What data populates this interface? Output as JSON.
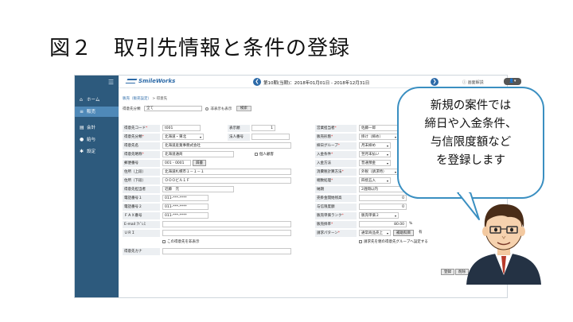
{
  "slide": {
    "title": "図２　取引先情報と条件の登録"
  },
  "sidebar": {
    "items": [
      {
        "label": "ホーム",
        "icon": "home-icon",
        "glyph": "⌂"
      },
      {
        "label": "販売",
        "icon": "sales-icon",
        "glyph": "≡"
      },
      {
        "label": "会計",
        "icon": "ledger-icon",
        "glyph": "▤"
      },
      {
        "label": "給与",
        "icon": "salary-icon",
        "glyph": "●"
      },
      {
        "label": "設定",
        "icon": "gear-icon",
        "glyph": "✱"
      }
    ]
  },
  "topbar": {
    "logo": "SmileWorks",
    "period": "第10期(当期)：2018年01月01日 - 2018年12月31日",
    "help": "画面解説"
  },
  "breadcrumb": {
    "parent": "販売（販売設定）",
    "separator": " > ",
    "current": "得意先"
  },
  "filter": {
    "label": "得意先分類",
    "value": "全て",
    "checkbox_label": "非表示も表示",
    "search_button": "検索"
  },
  "form": {
    "left": {
      "customer_code": {
        "label": "得意先コード",
        "value": "t001"
      },
      "display_order": {
        "label": "表示順",
        "value": "1"
      },
      "customer_class": {
        "label": "得意先分類",
        "value": "北海道・東北"
      },
      "corp_number": {
        "label": "法人番号",
        "value": ""
      },
      "customer_name": {
        "label": "得意先名",
        "value": "北海道産業事務式会社"
      },
      "customer_short": {
        "label": "得意先略称",
        "value": "北海道通商"
      },
      "individual": {
        "label": "個人顧客"
      },
      "postal": {
        "label": "郵便番号",
        "value": "001 - 0001",
        "button": "辞書"
      },
      "address1": {
        "label": "住所（上段）",
        "value": "北海道札幌市１－１－１"
      },
      "address2": {
        "label": "住所（下段）",
        "value": "ＯＯＯビル１Ｆ"
      },
      "contact": {
        "label": "得意先担当者",
        "value": "近藤　元"
      },
      "phone1": {
        "label": "電話番号１",
        "value": "011-***-****"
      },
      "phone2": {
        "label": "電話番号２",
        "value": "011-***-****"
      },
      "fax": {
        "label": "ＦＡＸ番号",
        "value": "011-***-****"
      },
      "email": {
        "label": "E-mail ｱﾄﾞﾚｽ",
        "value": ""
      },
      "url": {
        "label": "ＵＲＩ",
        "value": ""
      },
      "hide_customer": {
        "label": "この得意先を非表示"
      },
      "customer_kana": {
        "label": "得意先カナ",
        "value": ""
      }
    },
    "right": {
      "sales_rep": {
        "label": "営業担当者",
        "value": "佐藤一郎"
      },
      "sales_form": {
        "label": "販売形態",
        "value": "掛け（締め）"
      },
      "closing_group": {
        "label": "締日グループ",
        "value": "月末締め"
      },
      "payment_terms": {
        "label": "入金条件",
        "value": "翌月末払い"
      },
      "payment_method": {
        "label": "入金方法",
        "value": "普通預金"
      },
      "tax_calc": {
        "label": "消費税計算方法",
        "value": "外税（請求時）"
      },
      "rounding": {
        "label": "端数処理",
        "value": "四捨五入"
      },
      "payment_site": {
        "label": "納期",
        "value": "2週間以内"
      },
      "opening_ar": {
        "label": "売掛金開始残高",
        "value": "0"
      },
      "credit_limit": {
        "label": "与信限度額",
        "value": "0"
      },
      "price_rank": {
        "label": "販売単価ランク",
        "value": "販売単価２"
      },
      "sales_rate": {
        "label": "販売掛率",
        "value": "80.00",
        "unit": "%"
      },
      "account_pattern": {
        "label": "請求パターン",
        "value": "通常商品売上",
        "button": "補助科目",
        "suffix": "有"
      },
      "use_group": {
        "label": "請求先を親の得意先グループへ設定する"
      }
    }
  },
  "buttons": {
    "register": "登録",
    "delete": "削除"
  },
  "bubble": {
    "lines": [
      "新規の案件では",
      "締日や入金条件、",
      "与信限度額など",
      "を登録します"
    ]
  },
  "colors": {
    "sidebar": "#2d5a7d",
    "accent": "#2c6aa8",
    "bubble_border": "#3a8fc1",
    "required": "#dd3333"
  }
}
